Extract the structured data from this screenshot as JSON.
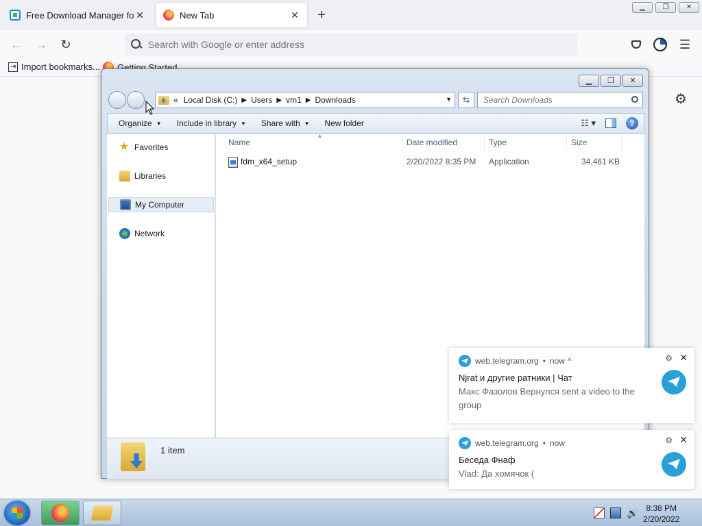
{
  "browser": {
    "tabs": [
      {
        "title": "Free Download Manager for Windows",
        "active": false
      },
      {
        "title": "New Tab",
        "active": true
      }
    ],
    "new_tab_symbol": "+",
    "window_controls": {
      "minimize": "▁",
      "restore": "❐",
      "close": "✕"
    },
    "nav": {
      "back": "←",
      "forward": "→",
      "reload": "↻"
    },
    "urlbar": {
      "placeholder": "Search with Google or enter address",
      "value": ""
    },
    "toolbar_icons": [
      "pocket-icon",
      "account-icon",
      "menu-icon"
    ],
    "menu_symbol": "☰",
    "bookmarks": [
      {
        "label": "Import bookmarks...",
        "icon": "import-icon"
      },
      {
        "label": "Getting Started",
        "icon": "firefox-icon"
      }
    ],
    "page_settings_symbol": "⚙"
  },
  "explorer": {
    "window_controls": {
      "minimize": "▁",
      "restore": "❐",
      "close": "✕"
    },
    "breadcrumb": [
      "«",
      "Local Disk (C:)",
      "Users",
      "vm1",
      "Downloads"
    ],
    "search_placeholder": "Search Downloads",
    "commands": [
      "Organize",
      "Include in library",
      "Share with",
      "New folder"
    ],
    "help_label": "?",
    "nav_items": [
      {
        "label": "Favorites",
        "icon": "star-icon",
        "selected": false
      },
      {
        "label": "Libraries",
        "icon": "libraries-icon",
        "selected": false
      },
      {
        "label": "My Computer",
        "icon": "computer-icon",
        "selected": true
      },
      {
        "label": "Network",
        "icon": "network-icon",
        "selected": false
      }
    ],
    "columns": [
      "Name",
      "Date modified",
      "Type",
      "Size"
    ],
    "files": [
      {
        "name": "fdm_x64_setup",
        "date": "2/20/2022 8:35 PM",
        "type": "Application",
        "size": "34,461 KB"
      }
    ],
    "status": "1 item"
  },
  "notifications": [
    {
      "source": "web.telegram.org",
      "time": "now",
      "expand": "^",
      "title": "Njrat и другие ратники | Чат",
      "body": "Макс  Фазолов Вернулся sent a video to the group"
    },
    {
      "source": "web.telegram.org",
      "time": "now",
      "expand": "",
      "title": "Беседа Фнаф",
      "body": "Vlad: Да хомячок ("
    }
  ],
  "taskbar": {
    "clock_time": "8:38 PM",
    "clock_date": "2/20/2022",
    "volume_symbol": "🔊"
  },
  "colors": {
    "telegram": "#2aa0da",
    "explorer_chrome": "#dbe5f1",
    "taskbar": "#b8cde3"
  }
}
